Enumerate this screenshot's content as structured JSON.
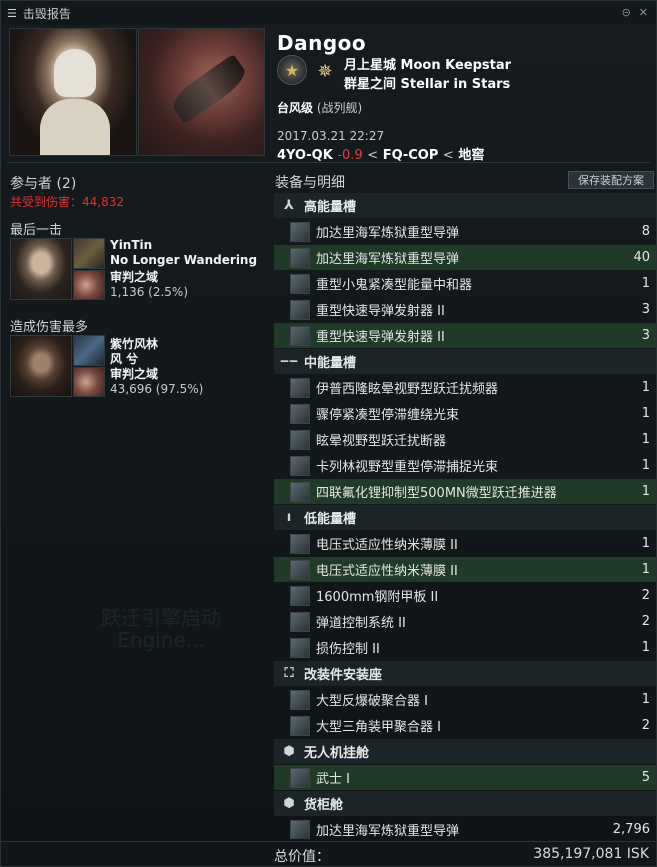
{
  "window": {
    "title": "击毁报告"
  },
  "victim": {
    "name": "Dangoo",
    "corp": "月上星城 Moon Keepstar",
    "alliance": "群星之间 Stellar in Stars",
    "ship_name": "台风级",
    "ship_class": "(战列舰)",
    "timestamp": "2017.03.21 22:27",
    "system": "4YO-QK",
    "security": "-0.9",
    "separator": "<",
    "constellation": "FQ-COP",
    "region": "地窖"
  },
  "participants": {
    "title": "参与者 (2)",
    "damage_received": "共受到伤害：44,832",
    "final_blow_label": "最后一击",
    "top_damage_label": "造成伤害最多",
    "final_blow": {
      "name": "YinTin",
      "corp": "No Longer Wandering",
      "alliance": "审判之域",
      "damage": "1,136 (2.5%)"
    },
    "top_damage": {
      "name": "紫竹风林",
      "corp": "风 兮",
      "alliance": "审判之域",
      "damage": "43,696 (97.5%)"
    }
  },
  "watermark": {
    "line1": "跃迁引擎启动",
    "line2": "Engine..."
  },
  "fitting": {
    "title": "装备与明细",
    "save_button": "保存装配方案",
    "sections": [
      {
        "key": "high",
        "icon": "high-slot-icon",
        "glyph": "⅄",
        "label": "高能量槽",
        "items": [
          {
            "name": "加达里海军炼狱重型导弹",
            "qty": "8",
            "state": "destroyed",
            "icon": "ic-missile"
          },
          {
            "name": "加达里海军炼狱重型导弹",
            "qty": "40",
            "state": "dropped",
            "icon": "ic-missile"
          },
          {
            "name": "重型小鬼紧凑型能量中和器",
            "qty": "1",
            "state": "destroyed",
            "icon": "ic-neut"
          },
          {
            "name": "重型快速导弹发射器 II",
            "qty": "3",
            "state": "destroyed",
            "icon": "ic-launcher"
          },
          {
            "name": "重型快速导弹发射器 II",
            "qty": "3",
            "state": "dropped",
            "icon": "ic-launcher"
          }
        ]
      },
      {
        "key": "mid",
        "icon": "mid-slot-icon",
        "glyph": "‒‒",
        "label": "中能量槽",
        "items": [
          {
            "name": "伊普西隆眩晕视野型跃迁扰频器",
            "qty": "1",
            "state": "destroyed",
            "icon": "ic-bcs"
          },
          {
            "name": "骤停紧凑型停滞缠绕光束",
            "qty": "1",
            "state": "destroyed",
            "icon": "ic-blue"
          },
          {
            "name": "眩晕视野型跃迁扰断器",
            "qty": "1",
            "state": "destroyed",
            "icon": "ic-bcs"
          },
          {
            "name": "卡列林视野型重型停滞捕捉光束",
            "qty": "1",
            "state": "destroyed",
            "icon": "ic-blue"
          },
          {
            "name": "四联氟化锂抑制型500MN微型跃迁推进器",
            "qty": "1",
            "state": "dropped",
            "icon": "ic-teal"
          }
        ]
      },
      {
        "key": "low",
        "icon": "low-slot-icon",
        "glyph": "ı",
        "label": "低能量槽",
        "items": [
          {
            "name": "电压式适应性纳米薄膜 II",
            "qty": "1",
            "state": "destroyed",
            "icon": "ic-armor"
          },
          {
            "name": "电压式适应性纳米薄膜 II",
            "qty": "1",
            "state": "dropped",
            "icon": "ic-armor"
          },
          {
            "name": "1600mm钢附甲板 II",
            "qty": "2",
            "state": "destroyed",
            "icon": "ic-armor"
          },
          {
            "name": "弹道控制系统 II",
            "qty": "2",
            "state": "destroyed",
            "icon": "ic-bcs"
          },
          {
            "name": "损伤控制 II",
            "qty": "1",
            "state": "destroyed",
            "icon": "ic-dc"
          }
        ]
      },
      {
        "key": "rig",
        "icon": "rig-slot-icon",
        "glyph": "⛶",
        "label": "改装件安装座",
        "items": [
          {
            "name": "大型反爆破聚合器 I",
            "qty": "1",
            "state": "destroyed",
            "icon": "ic-rig"
          },
          {
            "name": "大型三角装甲聚合器 I",
            "qty": "2",
            "state": "destroyed",
            "icon": "ic-rig"
          }
        ]
      },
      {
        "key": "drone",
        "icon": "drone-bay-icon",
        "glyph": "⬢",
        "label": "无人机挂舱",
        "items": [
          {
            "name": "武士 I",
            "qty": "5",
            "state": "dropped",
            "icon": "ic-drone"
          }
        ]
      },
      {
        "key": "cargo",
        "icon": "cargo-hold-icon",
        "glyph": "⬢",
        "label": "货柜舱",
        "items": [
          {
            "name": "加达里海军炼狱重型导弹",
            "qty": "2,796",
            "state": "destroyed",
            "icon": "ic-missile"
          }
        ]
      }
    ]
  },
  "total": {
    "label": "总价值：",
    "value": "385,197,081 ISK"
  },
  "colors": {
    "dropped_bg": "#1f3a26",
    "security": "#e04040",
    "damage_red": "#e03030"
  }
}
